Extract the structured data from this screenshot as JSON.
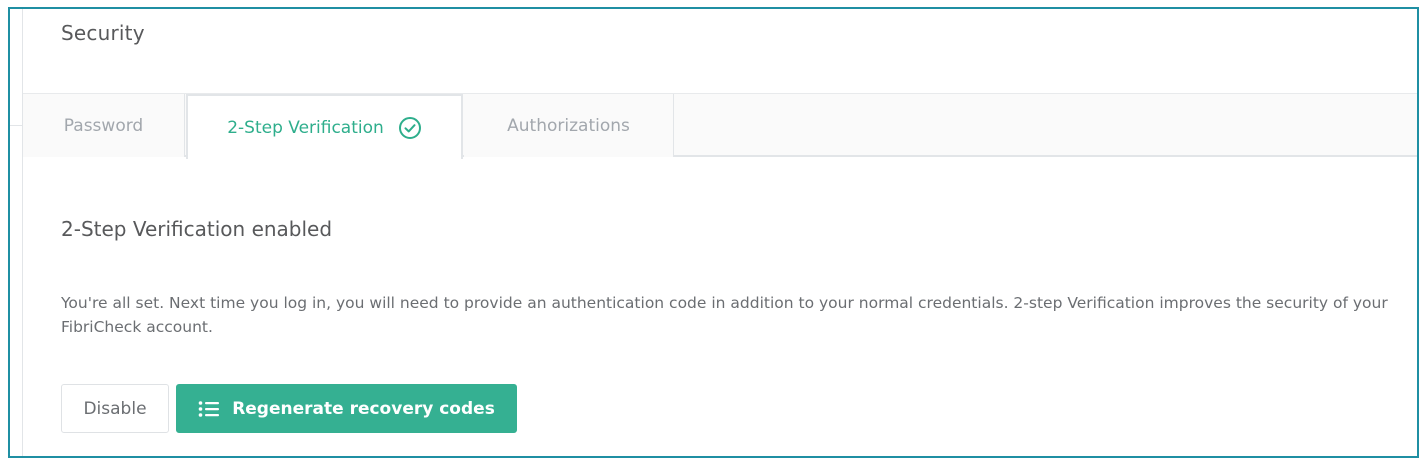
{
  "card": {
    "title": "Security"
  },
  "tabs": [
    {
      "label": "Password",
      "active": false
    },
    {
      "label": "2-Step Verification",
      "active": true,
      "icon": "check-circle-icon"
    },
    {
      "label": "Authorizations",
      "active": false
    }
  ],
  "content": {
    "heading": "2-Step Verification enabled",
    "description": "You're all set. Next time you log in, you will need to provide an authentication code in addition to your normal credentials. 2-step Verification improves the security of your FibriCheck account."
  },
  "buttons": {
    "disable_label": "Disable",
    "regenerate_label": "Regenerate recovery codes",
    "regenerate_icon": "list-icon"
  },
  "colors": {
    "accent": "#35b092",
    "active_tab_text": "#2eae8c",
    "inactive_tab_text": "#a2a7ad",
    "frame_border": "#1f8fa3"
  }
}
